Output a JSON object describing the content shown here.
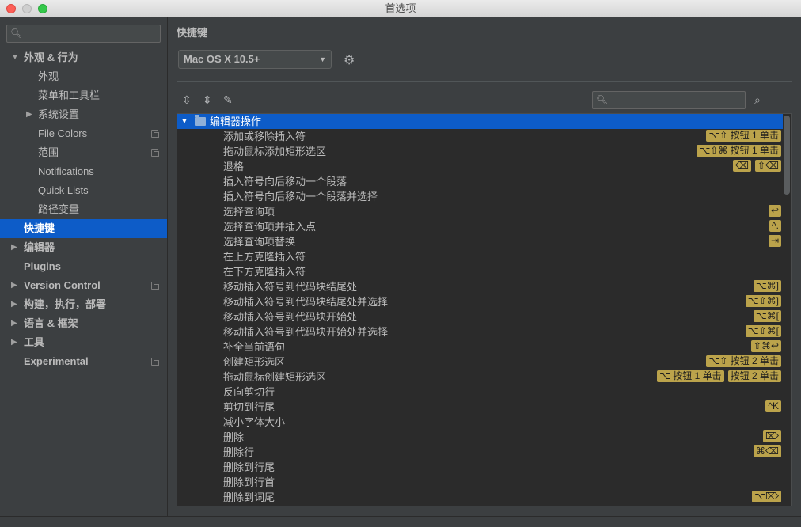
{
  "window": {
    "title": "首选项"
  },
  "sidebar": {
    "search_placeholder": "",
    "items": [
      {
        "label": "外观 & 行为",
        "arrow": "▼",
        "bold": true
      },
      {
        "label": "外观"
      },
      {
        "label": "菜单和工具栏"
      },
      {
        "label": "系统设置",
        "arrow": "▶"
      },
      {
        "label": "File Colors",
        "copy": true
      },
      {
        "label": "范围",
        "copy": true
      },
      {
        "label": "Notifications"
      },
      {
        "label": "Quick Lists"
      },
      {
        "label": "路径变量"
      },
      {
        "label": "快捷键",
        "bold": true,
        "selected": true
      },
      {
        "label": "编辑器",
        "arrow": "▶",
        "bold": true
      },
      {
        "label": "Plugins",
        "bold": true
      },
      {
        "label": "Version Control",
        "arrow": "▶",
        "bold": true,
        "copy": true
      },
      {
        "label": "构建，执行，部署",
        "arrow": "▶",
        "bold": true
      },
      {
        "label": "语言 & 框架",
        "arrow": "▶",
        "bold": true
      },
      {
        "label": "工具",
        "arrow": "▶",
        "bold": true
      },
      {
        "label": "Experimental",
        "bold": true,
        "copy": true
      }
    ]
  },
  "main": {
    "title": "快捷键",
    "keymap": "Mac OS X 10.5+",
    "search_placeholder": "",
    "group": {
      "label": "编辑器操作",
      "expand": "▼"
    },
    "actions": [
      {
        "label": "添加或移除插入符",
        "keys": [
          "⌥⇧ 按钮 1 单击"
        ]
      },
      {
        "label": "拖动鼠标添加矩形选区",
        "keys": [
          "⌥⇧⌘ 按钮 1 单击"
        ]
      },
      {
        "label": "退格",
        "keys": [
          "⌫",
          "⇧⌫"
        ]
      },
      {
        "label": "插入符号向后移动一个段落",
        "keys": []
      },
      {
        "label": "插入符号向后移动一个段落并选择",
        "keys": []
      },
      {
        "label": "选择查询项",
        "keys": [
          "↩"
        ]
      },
      {
        "label": "选择查询项并插入点",
        "keys": [
          "^."
        ]
      },
      {
        "label": "选择查询项替换",
        "keys": [
          "⇥"
        ]
      },
      {
        "label": "在上方克隆插入符",
        "keys": []
      },
      {
        "label": "在下方克隆插入符",
        "keys": []
      },
      {
        "label": "移动插入符号到代码块结尾处",
        "keys": [
          "⌥⌘]"
        ]
      },
      {
        "label": "移动插入符号到代码块结尾处并选择",
        "keys": [
          "⌥⇧⌘]"
        ]
      },
      {
        "label": "移动插入符号到代码块开始处",
        "keys": [
          "⌥⌘["
        ]
      },
      {
        "label": "移动插入符号到代码块开始处并选择",
        "keys": [
          "⌥⇧⌘["
        ]
      },
      {
        "label": "补全当前语句",
        "keys": [
          "⇧⌘↩"
        ]
      },
      {
        "label": "创建矩形选区",
        "keys": [
          "⌥⇧ 按钮 2 单击"
        ]
      },
      {
        "label": "拖动鼠标创建矩形选区",
        "keys": [
          "⌥ 按钮 1 单击",
          "按钮 2 单击"
        ]
      },
      {
        "label": "反向剪切行",
        "keys": []
      },
      {
        "label": "剪切到行尾",
        "keys": [
          "^K"
        ]
      },
      {
        "label": "减小字体大小",
        "keys": []
      },
      {
        "label": "删除",
        "keys": [
          "⌦"
        ]
      },
      {
        "label": "删除行",
        "keys": [
          "⌘⌫"
        ]
      },
      {
        "label": "删除到行尾",
        "keys": []
      },
      {
        "label": "删除到行首",
        "keys": []
      },
      {
        "label": "删除到词尾",
        "keys": [
          "⌥⌦"
        ]
      }
    ]
  },
  "colors": {
    "selection": "#0d5cc8",
    "shortcut_bg": "#bba34b",
    "panel": "#3c3f41",
    "tree_bg": "#2b2b2b"
  },
  "icons": [
    "search-icon",
    "gear-icon",
    "expand-all-icon",
    "collapse-all-icon",
    "edit-icon",
    "find-shortcut-icon",
    "folder-icon",
    "copy-icon"
  ]
}
